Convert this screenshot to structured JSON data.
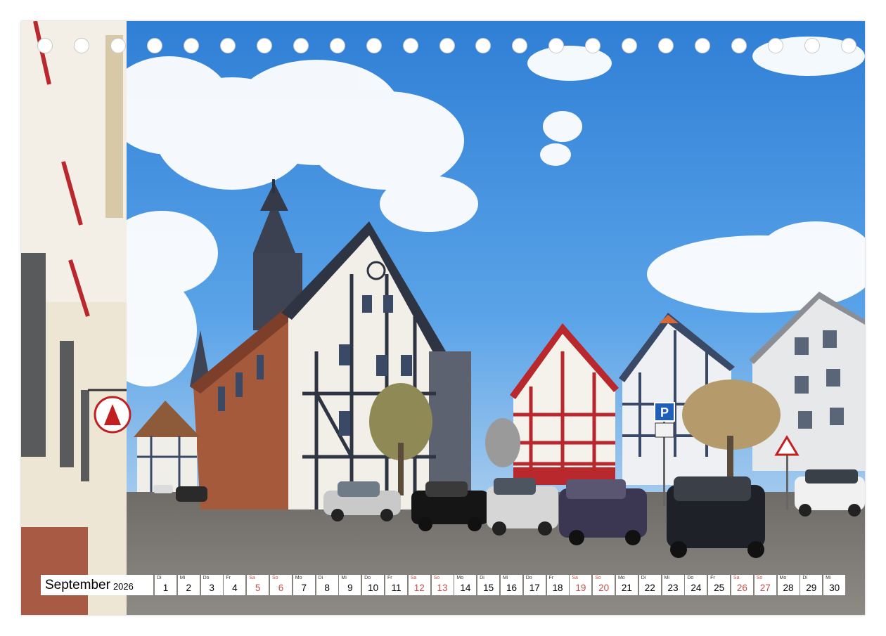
{
  "calendar": {
    "month": "September",
    "year": "2026",
    "days": [
      {
        "dow": "Di",
        "num": "1",
        "weekend": false
      },
      {
        "dow": "Mi",
        "num": "2",
        "weekend": false
      },
      {
        "dow": "Do",
        "num": "3",
        "weekend": false
      },
      {
        "dow": "Fr",
        "num": "4",
        "weekend": false
      },
      {
        "dow": "Sa",
        "num": "5",
        "weekend": true
      },
      {
        "dow": "So",
        "num": "6",
        "weekend": true
      },
      {
        "dow": "Mo",
        "num": "7",
        "weekend": false
      },
      {
        "dow": "Di",
        "num": "8",
        "weekend": false
      },
      {
        "dow": "Mi",
        "num": "9",
        "weekend": false
      },
      {
        "dow": "Do",
        "num": "10",
        "weekend": false
      },
      {
        "dow": "Fr",
        "num": "11",
        "weekend": false
      },
      {
        "dow": "Sa",
        "num": "12",
        "weekend": true
      },
      {
        "dow": "So",
        "num": "13",
        "weekend": true
      },
      {
        "dow": "Mo",
        "num": "14",
        "weekend": false
      },
      {
        "dow": "Di",
        "num": "15",
        "weekend": false
      },
      {
        "dow": "Mi",
        "num": "16",
        "weekend": false
      },
      {
        "dow": "Do",
        "num": "17",
        "weekend": false
      },
      {
        "dow": "Fr",
        "num": "18",
        "weekend": false
      },
      {
        "dow": "Sa",
        "num": "19",
        "weekend": true
      },
      {
        "dow": "So",
        "num": "20",
        "weekend": true
      },
      {
        "dow": "Mo",
        "num": "21",
        "weekend": false
      },
      {
        "dow": "Di",
        "num": "22",
        "weekend": false
      },
      {
        "dow": "Mi",
        "num": "23",
        "weekend": false
      },
      {
        "dow": "Do",
        "num": "24",
        "weekend": false
      },
      {
        "dow": "Fr",
        "num": "25",
        "weekend": false
      },
      {
        "dow": "Sa",
        "num": "26",
        "weekend": true
      },
      {
        "dow": "So",
        "num": "27",
        "weekend": true
      },
      {
        "dow": "Mo",
        "num": "28",
        "weekend": false
      },
      {
        "dow": "Di",
        "num": "29",
        "weekend": false
      },
      {
        "dow": "Mi",
        "num": "30",
        "weekend": false
      }
    ]
  },
  "signs": {
    "parking": "P"
  },
  "colors": {
    "weekend": "#c0504d",
    "sky": "#3f8fdc",
    "timber_red": "#b8282c",
    "sandstone": "#a65a3c"
  },
  "binding_hole_count": 23
}
